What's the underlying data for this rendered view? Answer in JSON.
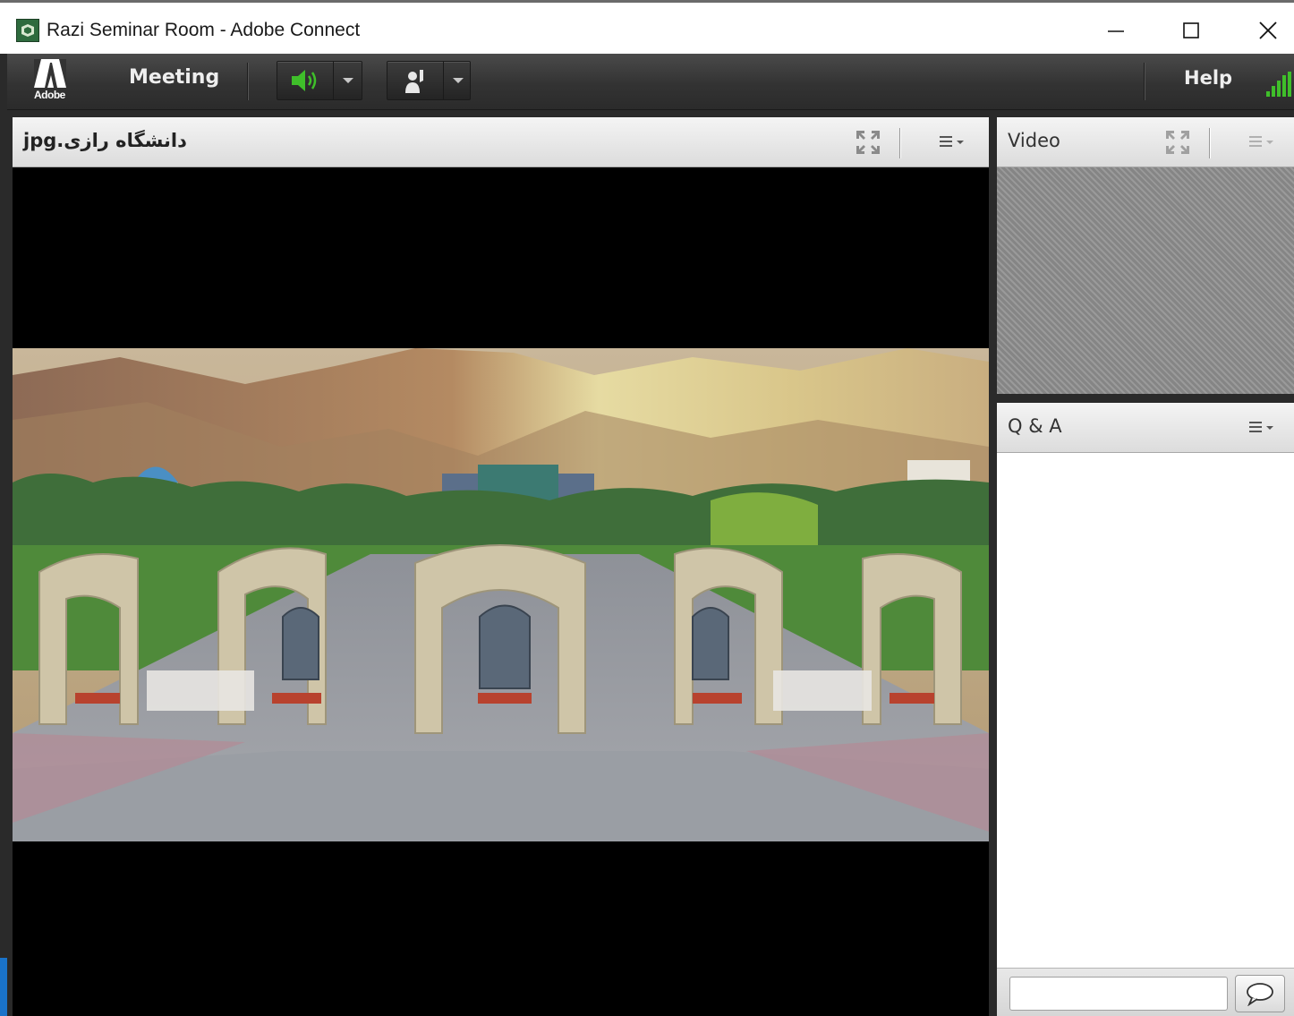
{
  "window": {
    "title": "Razi Seminar Room - Adobe Connect",
    "controls": [
      "minimize",
      "maximize",
      "close"
    ]
  },
  "toolbar": {
    "logo_text": "Adobe",
    "meeting_menu": "Meeting",
    "help_menu": "Help",
    "audio_state": "speaker-on",
    "accent_green": "#3fbf2a"
  },
  "share_pod": {
    "title": "دانشگاه رازی.jpg",
    "content": "campus-entrance-photo"
  },
  "video_pod": {
    "title": "Video"
  },
  "qa_pod": {
    "title": "Q & A",
    "input_value": "",
    "input_placeholder": ""
  }
}
